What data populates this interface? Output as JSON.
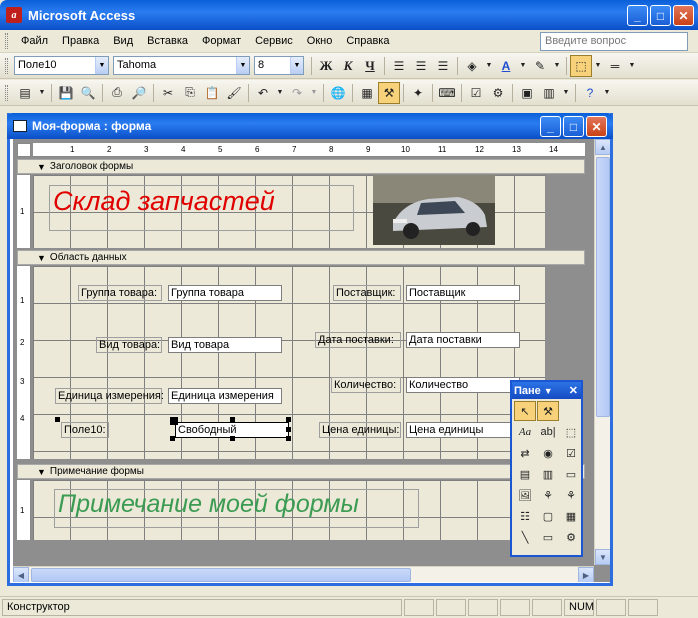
{
  "app": {
    "title": "Microsoft Access"
  },
  "menubar": {
    "items": [
      "Файл",
      "Правка",
      "Вид",
      "Вставка",
      "Формат",
      "Сервис",
      "Окно",
      "Справка"
    ],
    "ask_placeholder": "Введите вопрос"
  },
  "format_toolbar": {
    "object": "Поле10",
    "font": "Tahoma",
    "size": "8",
    "bold_glyph": "Ж",
    "italic_glyph": "К",
    "underline_glyph": "Ч"
  },
  "document": {
    "title": "Моя-форма : форма",
    "sections": {
      "header": "Заголовок формы",
      "detail": "Область данных",
      "footer": "Примечание формы"
    },
    "header_title": "Склад запчастей",
    "footer_text": "Примечание моей формы",
    "controls": [
      {
        "label": "Группа товара:",
        "field": "Группа товара"
      },
      {
        "label": "Вид товара:",
        "field": "Вид товара"
      },
      {
        "label": "Единица измерения:",
        "field": "Единица измерения"
      },
      {
        "label": "Поле10:",
        "field": "Свободный"
      },
      {
        "label": "Поставщик:",
        "field": "Поставщик"
      },
      {
        "label": "Дата поставки:",
        "field": "Дата поставки"
      },
      {
        "label": "Количество:",
        "field": "Количество"
      },
      {
        "label": "Цена единицы:",
        "field": "Цена единицы"
      }
    ],
    "ruler_numbers": [
      "1",
      "2",
      "3",
      "4",
      "5",
      "6",
      "7",
      "8",
      "9",
      "10",
      "11",
      "12",
      "13",
      "14"
    ],
    "vruler_numbers": [
      "1",
      "1",
      "2",
      "3",
      "4",
      "1"
    ]
  },
  "toolbox": {
    "title": "Пане"
  },
  "status": {
    "mode": "Конструктор",
    "num": "NUM"
  },
  "colors": {
    "title_text": "#e00000",
    "footer_text": "#3b9b52",
    "xp_blue": "#0a5fd8"
  }
}
